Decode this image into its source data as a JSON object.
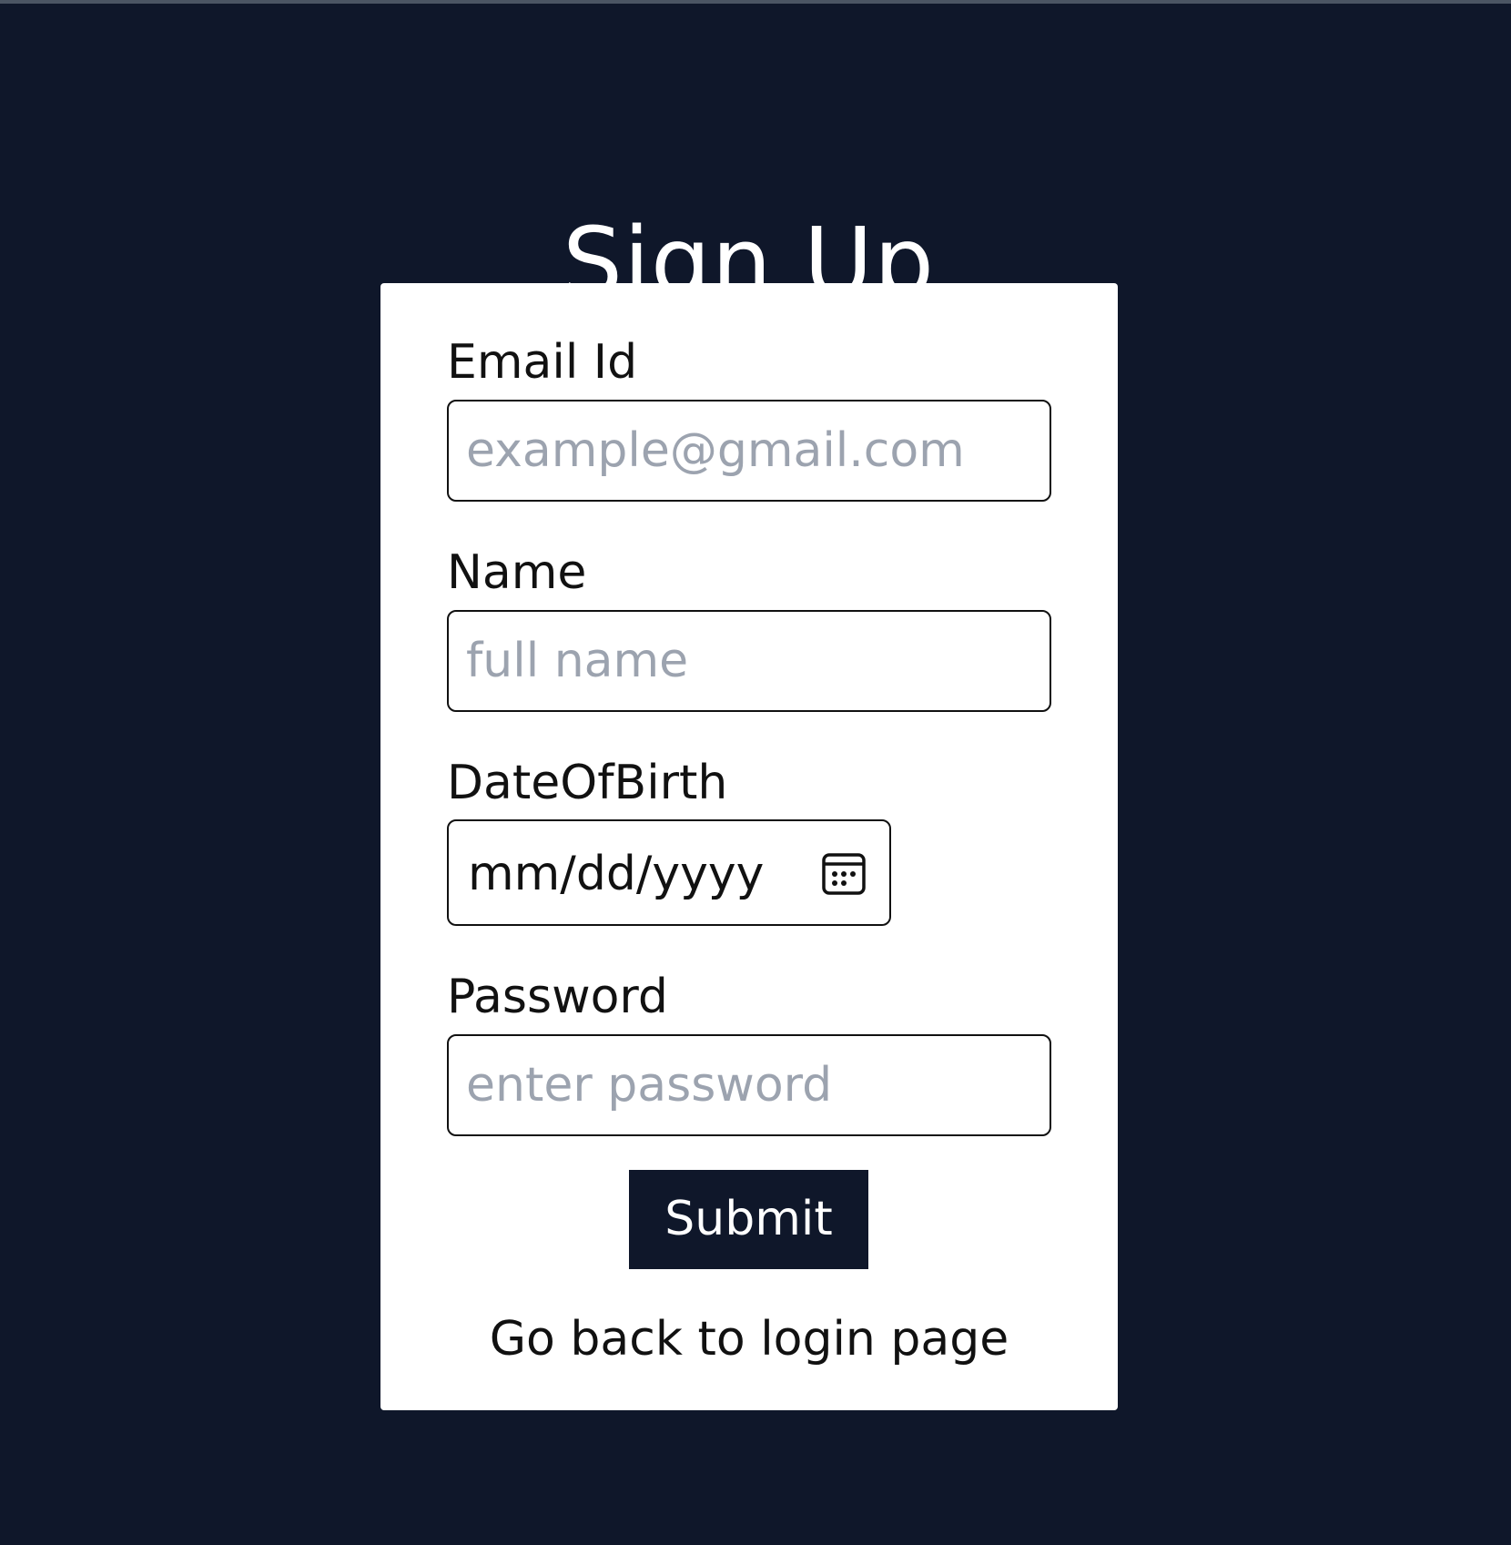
{
  "page": {
    "title": "Sign Up"
  },
  "form": {
    "email": {
      "label": "Email Id",
      "placeholder": "example@gmail.com",
      "value": ""
    },
    "name": {
      "label": "Name",
      "placeholder": "full name",
      "value": ""
    },
    "dob": {
      "label": "DateOfBirth",
      "display": "mm/dd/yyyy",
      "icon": "calendar-icon"
    },
    "password": {
      "label": "Password",
      "placeholder": "enter password",
      "value": ""
    },
    "submit_label": "Submit",
    "back_link_label": "Go back to login page"
  },
  "colors": {
    "background": "#0f172a",
    "card": "#ffffff",
    "button": "#0f172a",
    "placeholder": "#9ca3af"
  }
}
